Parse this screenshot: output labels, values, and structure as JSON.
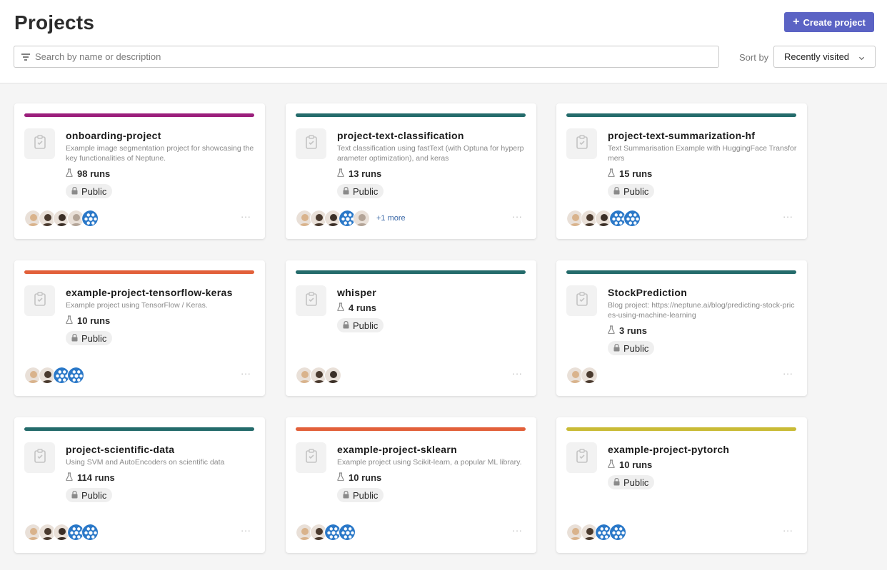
{
  "header": {
    "title": "Projects",
    "create_label": "Create project",
    "search_placeholder": "Search by name or description",
    "sort_label": "Sort by",
    "sort_value": "Recently visited"
  },
  "colors": {
    "accent": "#5b63c4",
    "magenta": "#9b1f7c",
    "teal": "#246b6b",
    "orange": "#e2603a",
    "yellow": "#c9bb36"
  },
  "avatar_styles": {
    "p1": "#d9b38c",
    "p2": "#4a3a2e",
    "p3": "#3b2f27",
    "p4": "#b3a497",
    "logo": "#2a78c8"
  },
  "projects": [
    {
      "name": "onboarding-project",
      "description": "Example image segmentation project for showcasing the key functionalities of Neptune.",
      "runs": "98 runs",
      "visibility": "Public",
      "bar_color": "#9b1f7c",
      "avatars": [
        "p1",
        "p2",
        "p3",
        "p4",
        "logo"
      ],
      "more": ""
    },
    {
      "name": "project-text-classification",
      "description": "Text classification using fastText (with Optuna for hyperparameter optimization), and keras",
      "runs": "13 runs",
      "visibility": "Public",
      "bar_color": "#246b6b",
      "avatars": [
        "p1",
        "p2",
        "p3",
        "logo",
        "p4"
      ],
      "more": "+1 more"
    },
    {
      "name": "project-text-summarization-hf",
      "description": "Text Summarisation Example with HuggingFace Transformers",
      "runs": "15 runs",
      "visibility": "Public",
      "bar_color": "#246b6b",
      "avatars": [
        "p1",
        "p2",
        "p3",
        "logo",
        "logo"
      ],
      "more": ""
    },
    {
      "name": "example-project-tensorflow-keras",
      "description": "Example project using TensorFlow / Keras.",
      "runs": "10 runs",
      "visibility": "Public",
      "bar_color": "#e2603a",
      "avatars": [
        "p1",
        "p2",
        "logo",
        "logo"
      ],
      "more": ""
    },
    {
      "name": "whisper",
      "description": "",
      "runs": "4 runs",
      "visibility": "Public",
      "bar_color": "#246b6b",
      "avatars": [
        "p1",
        "p2",
        "p3"
      ],
      "more": ""
    },
    {
      "name": "StockPrediction",
      "description": "Blog project: https://neptune.ai/blog/predicting-stock-prices-using-machine-learning",
      "runs": "3 runs",
      "visibility": "Public",
      "bar_color": "#246b6b",
      "avatars": [
        "p1",
        "p2"
      ],
      "more": ""
    },
    {
      "name": "project-scientific-data",
      "description": "Using SVM and AutoEncoders on scientific data",
      "runs": "114 runs",
      "visibility": "Public",
      "bar_color": "#246b6b",
      "avatars": [
        "p1",
        "p2",
        "p3",
        "logo",
        "logo"
      ],
      "more": ""
    },
    {
      "name": "example-project-sklearn",
      "description": "Example project using Scikit-learn, a popular ML library.",
      "runs": "10 runs",
      "visibility": "Public",
      "bar_color": "#e2603a",
      "avatars": [
        "p1",
        "p2",
        "logo",
        "logo"
      ],
      "more": ""
    },
    {
      "name": "example-project-pytorch",
      "description": "",
      "runs": "10 runs",
      "visibility": "Public",
      "bar_color": "#c9bb36",
      "avatars": [
        "p1",
        "p2",
        "logo",
        "logo"
      ],
      "more": ""
    }
  ]
}
